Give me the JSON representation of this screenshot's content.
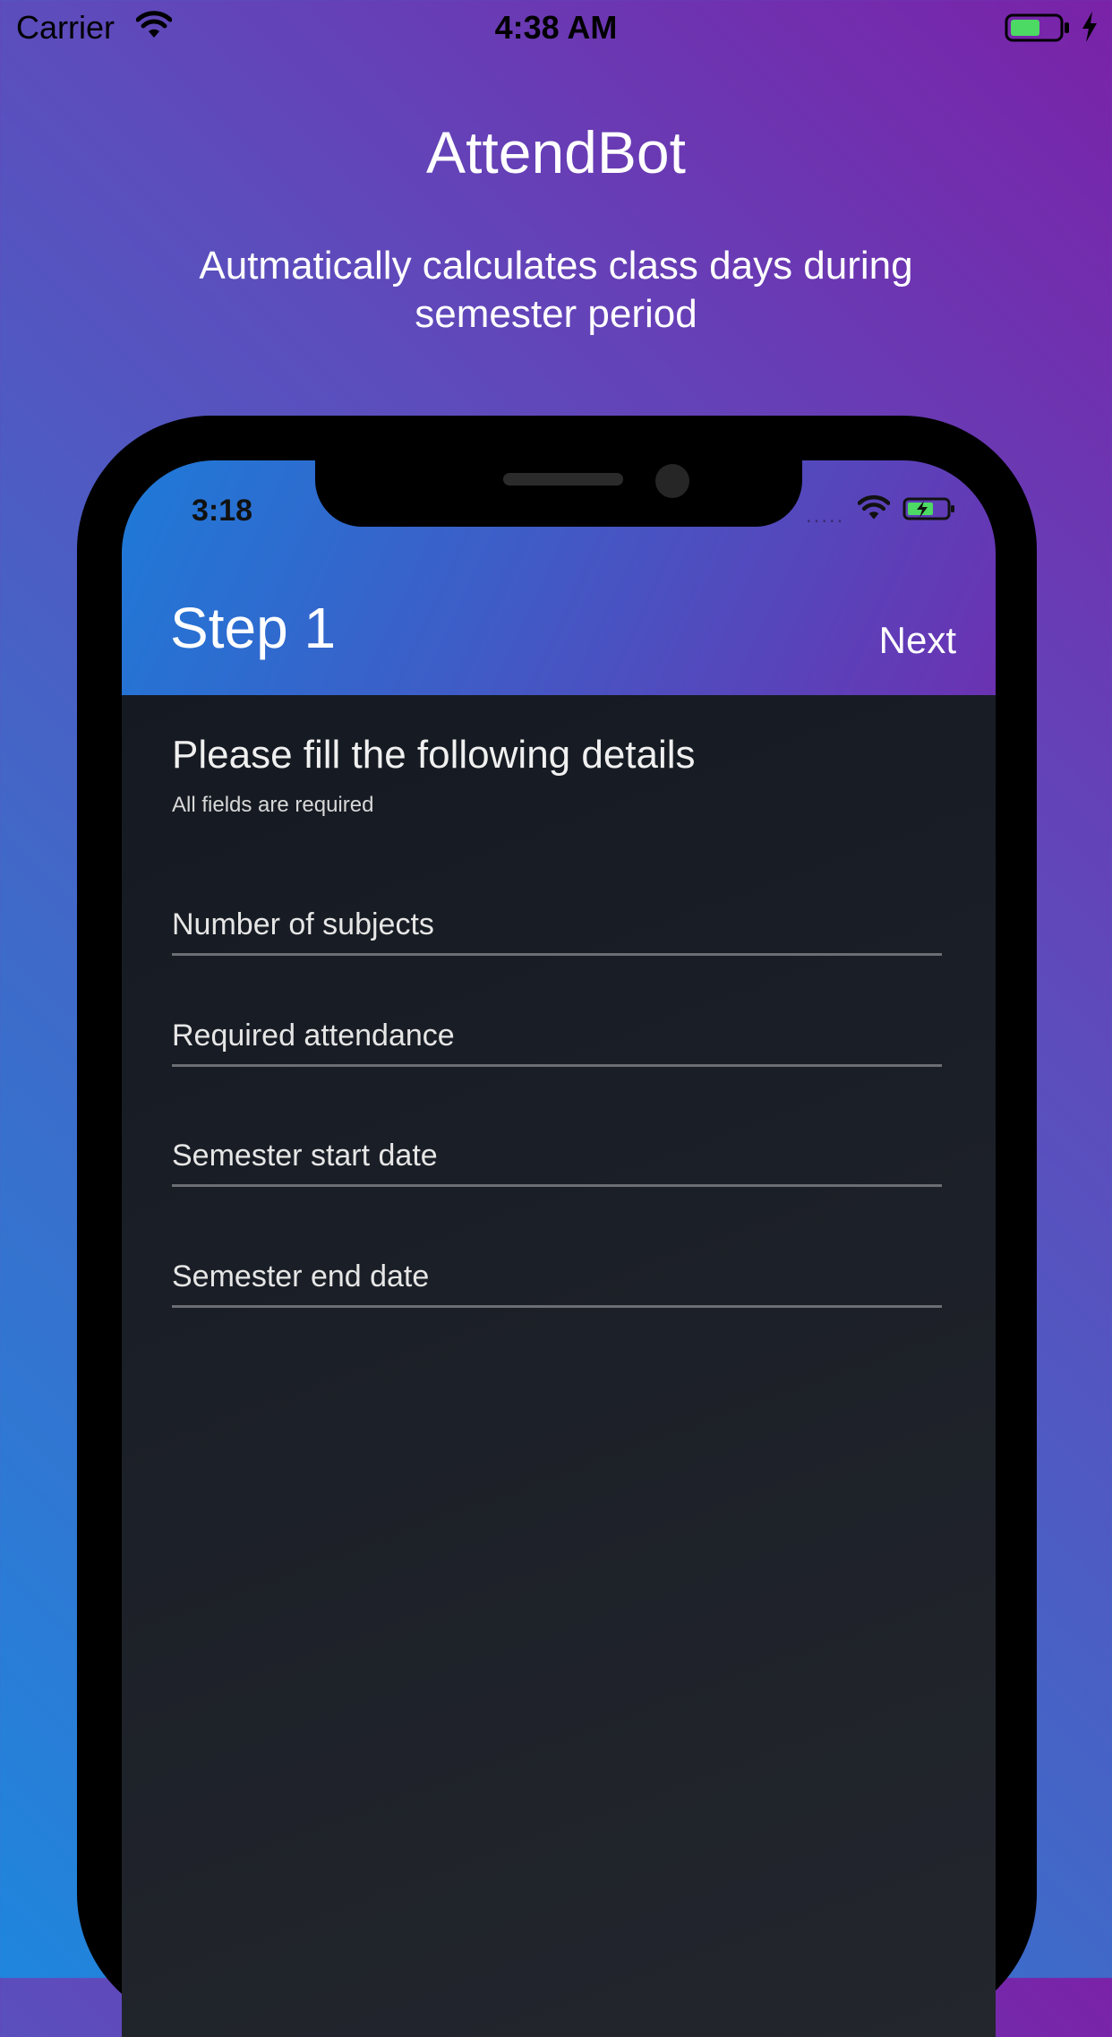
{
  "outer_status_bar": {
    "carrier": "Carrier",
    "time": "4:38 AM",
    "icons": [
      "wifi-icon",
      "battery-icon",
      "charging-bolt-icon"
    ]
  },
  "promo": {
    "title": "AttendBot",
    "tagline": "Autmatically calculates class days during semester period"
  },
  "device": {
    "status_bar": {
      "time": "3:18",
      "signal": ".....",
      "icons": [
        "wifi-icon",
        "battery-charging-icon"
      ]
    },
    "header": {
      "title": "Step 1",
      "next_label": "Next"
    },
    "form": {
      "heading": "Please fill the following details",
      "subheading": "All fields are required",
      "fields": [
        {
          "label": "Number of subjects"
        },
        {
          "label": "Required attendance"
        },
        {
          "label": "Semester start date"
        },
        {
          "label": "Semester end date"
        }
      ]
    }
  },
  "colors": {
    "background_gradient": [
      "#7a22a8",
      "#1f86dd"
    ],
    "header_gradient": [
      "#1e7ad8",
      "#6b32b2"
    ],
    "screen_background": "#1b1f27",
    "battery_fill": "#4cd964"
  }
}
